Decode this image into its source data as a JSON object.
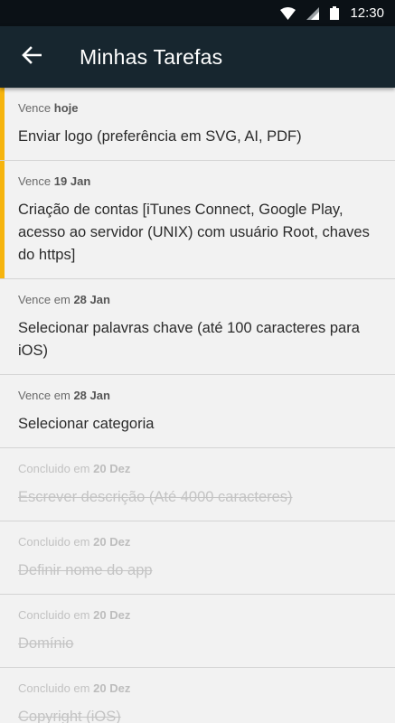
{
  "status_bar": {
    "time": "12:30"
  },
  "app_bar": {
    "title": "Minhas Tarefas"
  },
  "tasks": [
    {
      "due_prefix": "Vence",
      "due_date": "hoje",
      "title": "Enviar logo (preferência em SVG, AI, PDF)",
      "status": "urgent"
    },
    {
      "due_prefix": "Vence",
      "due_date": "19 Jan",
      "title": "Criação de contas [iTunes Connect, Google Play, acesso ao servidor (UNIX) com usuário Root, chaves do https]",
      "status": "urgent"
    },
    {
      "due_prefix": "Vence em",
      "due_date": "28 Jan",
      "title": "Selecionar palavras chave (até 100 caracteres para iOS)",
      "status": "pending"
    },
    {
      "due_prefix": "Vence em",
      "due_date": "28 Jan",
      "title": "Selecionar categoria",
      "status": "pending"
    },
    {
      "due_prefix": "Concluido em",
      "due_date": "20 Dez",
      "title": "Escrever descrição (Até 4000 caracteres)",
      "status": "done"
    },
    {
      "due_prefix": "Concluido em",
      "due_date": "20 Dez",
      "title": "Definir nome do app",
      "status": "done"
    },
    {
      "due_prefix": "Concluido em",
      "due_date": "20 Dez",
      "title": "Domínio",
      "status": "done"
    },
    {
      "due_prefix": "Concluido em",
      "due_date": "20 Dez",
      "title": "Copyright (iOS)",
      "status": "done"
    }
  ],
  "colors": {
    "status_bar": "#0b1116",
    "app_bar": "#17262f",
    "urgent_accent": "#f6b40e",
    "background": "#f2f2f2"
  },
  "icons": {
    "back": "arrow-left-icon",
    "wifi": "wifi-icon",
    "signal": "cell-signal-icon",
    "battery": "battery-icon"
  }
}
